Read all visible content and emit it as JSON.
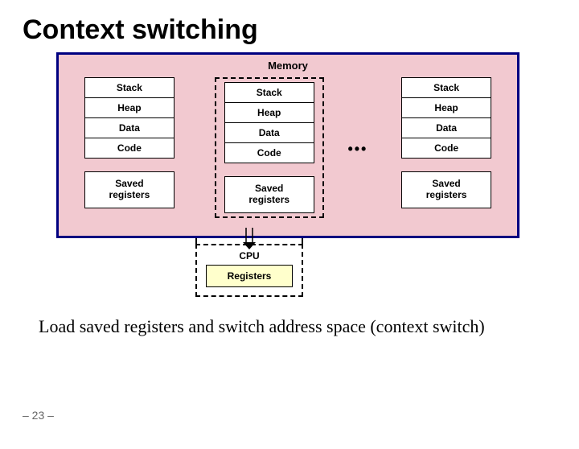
{
  "title": "Context switching",
  "memory_label": "Memory",
  "segments": [
    "Stack",
    "Heap",
    "Data",
    "Code"
  ],
  "saved_registers_label": "Saved\nregisters",
  "ellipsis": "•••",
  "cpu_label": "CPU",
  "cpu_registers_label": "Registers",
  "body_text": "Load saved registers and switch address space (context switch)",
  "slide_number": "– 23 –",
  "process_count": 3,
  "highlighted_process_index": 1
}
